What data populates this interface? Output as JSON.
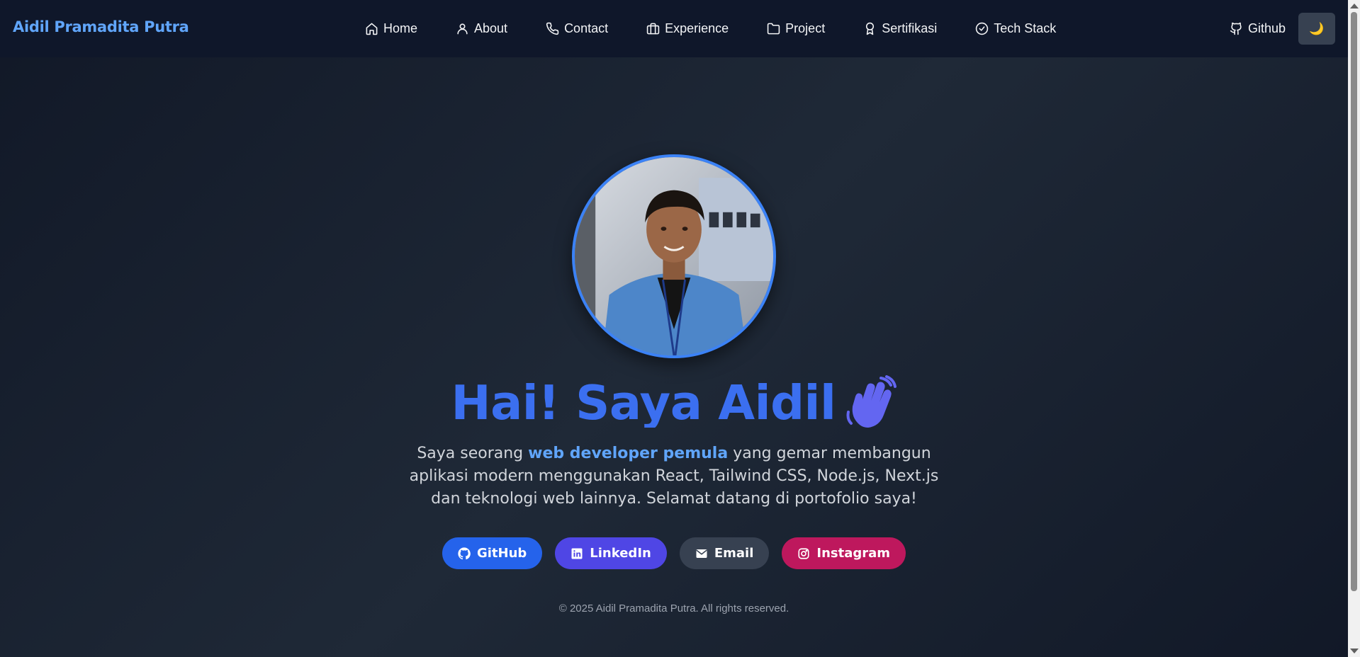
{
  "navbar": {
    "brand": "Aidil Pramadita Putra",
    "items": [
      {
        "label": "Home",
        "icon": "home-icon"
      },
      {
        "label": "About",
        "icon": "user-icon"
      },
      {
        "label": "Contact",
        "icon": "phone-icon"
      },
      {
        "label": "Experience",
        "icon": "briefcase-icon"
      },
      {
        "label": "Project",
        "icon": "folder-icon"
      },
      {
        "label": "Sertifikasi",
        "icon": "award-icon"
      },
      {
        "label": "Tech Stack",
        "icon": "check-circle-icon"
      }
    ],
    "github_label": "Github",
    "theme_toggle": "🌙"
  },
  "hero": {
    "title": "Hai! Saya Aidil",
    "desc_pre": "Saya seorang ",
    "desc_highlight": "web developer pemula",
    "desc_post": " yang gemar membangun aplikasi modern menggunakan React, Tailwind CSS, Node.js, Next.js dan teknologi web lainnya. Selamat datang di portofolio saya!"
  },
  "socials": [
    {
      "label": "GitHub",
      "color": "#2563eb"
    },
    {
      "label": "LinkedIn",
      "color": "#4f46e5"
    },
    {
      "label": "Email",
      "color": "#374151"
    },
    {
      "label": "Instagram",
      "color": "#be185d"
    }
  ],
  "footer": "© 2025 Aidil Pramadita Putra. All rights reserved.",
  "colors": {
    "accent": "#3b82f6",
    "brand": "#60a5fa",
    "nav_bg": "#0f172a"
  }
}
